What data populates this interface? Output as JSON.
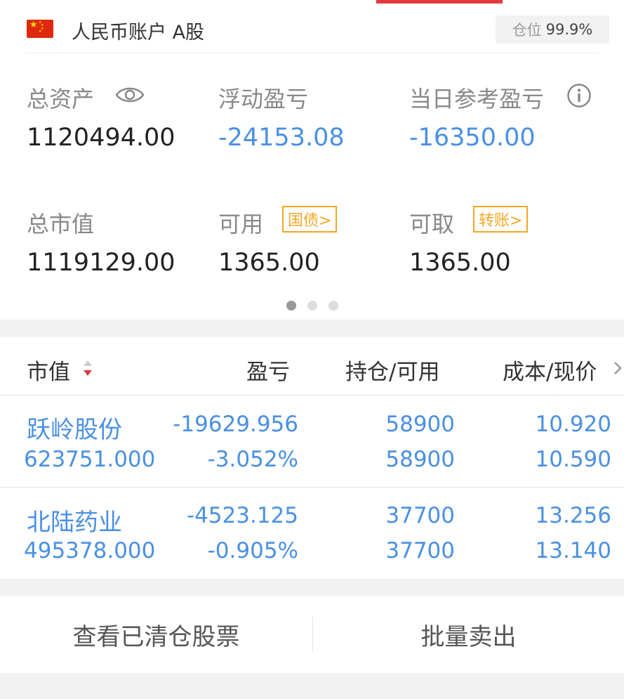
{
  "account": {
    "flag": "china-flag-icon",
    "name": "人民币账户 A股",
    "position_label": "仓位",
    "position_value": "99.9%"
  },
  "stats": {
    "total_assets_label": "总资产",
    "total_assets_value": "1120494.00",
    "floating_pl_label": "浮动盈亏",
    "floating_pl_value": "-24153.08",
    "daily_pl_label": "当日参考盈亏",
    "daily_pl_value": "-16350.00",
    "market_value_label": "总市值",
    "market_value_value": "1119129.00",
    "available_label": "可用",
    "available_tag": "国债>",
    "available_value": "1365.00",
    "withdrawable_label": "可取",
    "withdrawable_tag": "转账>",
    "withdrawable_value": "1365.00"
  },
  "pager": {
    "pages": 3,
    "active": 0
  },
  "table": {
    "headers": [
      "市值",
      "盈亏",
      "持仓/可用",
      "成本/现价"
    ],
    "rows": [
      {
        "name": "跃岭股份",
        "market_value": "623751.000",
        "pl": "-19629.956",
        "pl_pct": "-3.052%",
        "holding": "58900",
        "available": "58900",
        "cost": "10.920",
        "price": "10.590"
      },
      {
        "name": "北陆药业",
        "market_value": "495378.000",
        "pl": "-4523.125",
        "pl_pct": "-0.905%",
        "holding": "37700",
        "available": "37700",
        "cost": "13.256",
        "price": "13.140"
      }
    ]
  },
  "actions": {
    "view_cleared": "查看已清仓股票",
    "batch_sell": "批量卖出"
  },
  "colors": {
    "accent_red": "#e2393c",
    "value_blue": "#4a90e2",
    "tag_orange": "#f5a623"
  }
}
